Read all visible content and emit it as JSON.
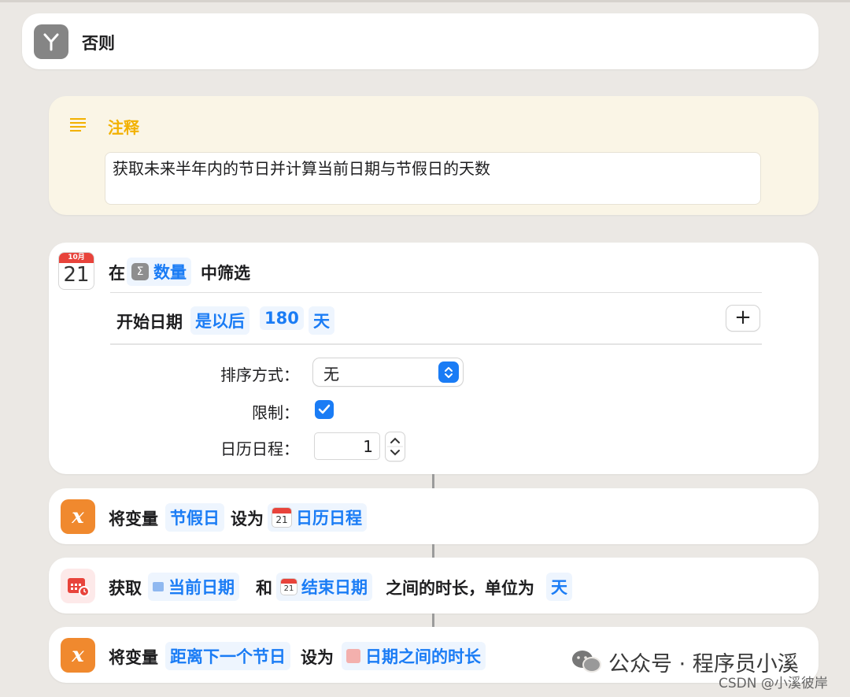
{
  "else_block": {
    "title": "否则",
    "icon": "branch-icon"
  },
  "comment": {
    "title": "注释",
    "text": "获取未来半年内的节日并计算当前日期与节假日的天数",
    "icon": "lines-icon"
  },
  "filter": {
    "prefix": "在",
    "source_token": "数量",
    "source_icon": "sigma-icon",
    "suffix": "中筛选",
    "calendar_icon": {
      "month": "10月",
      "day": "21"
    },
    "condition": {
      "field": "开始日期",
      "operator": "是以后",
      "value": "180",
      "unit": "天"
    },
    "sort_label": "排序方式：",
    "sort_value": "无",
    "limit_label": "限制：",
    "limit_checked": true,
    "count_label": "日历日程：",
    "count_value": "1"
  },
  "set_var_1": {
    "prefix": "将变量",
    "variable": "节假日",
    "middle": "设为",
    "value": "日历日程",
    "value_icon_day": "21"
  },
  "get_duration": {
    "prefix": "获取",
    "start": "当前日期",
    "and": "和",
    "end": "结束日期",
    "end_icon_day": "21",
    "middle": "之间的时长，单位为",
    "unit": "天"
  },
  "set_var_2": {
    "prefix": "将变量",
    "variable": "距离下一个节日",
    "middle": "设为",
    "value": "日期之间的时长"
  },
  "watermark": {
    "text": "公众号 · 程序员小溪",
    "csdn": "CSDN @小溪彼岸"
  },
  "colors": {
    "accent": "#1a7cf5",
    "comment_title": "#f2b100",
    "variable_icon": "#f0892e",
    "calendar_red": "#e8433b"
  }
}
